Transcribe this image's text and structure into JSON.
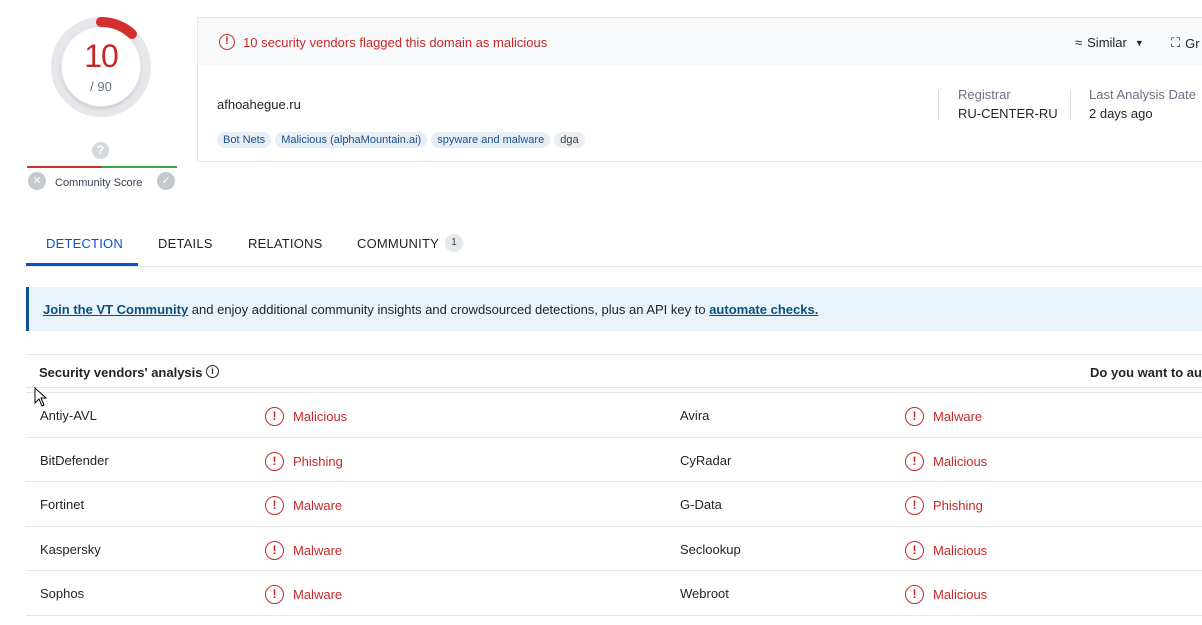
{
  "score": {
    "detections": "10",
    "total": "/ 90",
    "community_label": "Community Score"
  },
  "alert": {
    "text": "10 security vendors flagged this domain as malicious"
  },
  "toolbar": {
    "similar_label": "Similar",
    "graph_label": "Gr"
  },
  "domain": "afhoahegue.ru",
  "tags": [
    "Bot Nets",
    "Malicious (alphaMountain.ai)",
    "spyware and malware",
    "dga"
  ],
  "meta": {
    "registrar_label": "Registrar",
    "registrar_value": "RU-CENTER-RU",
    "last_analysis_label": "Last Analysis Date",
    "last_analysis_value": "2 days ago"
  },
  "tabs": [
    {
      "label": "DETECTION"
    },
    {
      "label": "DETAILS"
    },
    {
      "label": "RELATIONS"
    },
    {
      "label": "COMMUNITY",
      "badge": "1"
    }
  ],
  "banner": {
    "link1": "Join the VT Community",
    "middle": " and enjoy additional community insights and crowdsourced detections, plus an API key to ",
    "link2": "automate checks."
  },
  "vendors": {
    "title": "Security vendors' analysis",
    "right_text": "Do you want to aut",
    "rows": [
      {
        "left": {
          "name": "Antiy-AVL",
          "result": "Malicious"
        },
        "right": {
          "name": "Avira",
          "result": "Malware"
        }
      },
      {
        "left": {
          "name": "BitDefender",
          "result": "Phishing"
        },
        "right": {
          "name": "CyRadar",
          "result": "Malicious"
        }
      },
      {
        "left": {
          "name": "Fortinet",
          "result": "Malware"
        },
        "right": {
          "name": "G-Data",
          "result": "Phishing"
        }
      },
      {
        "left": {
          "name": "Kaspersky",
          "result": "Malware"
        },
        "right": {
          "name": "Seclookup",
          "result": "Malicious"
        }
      },
      {
        "left": {
          "name": "Sophos",
          "result": "Malware"
        },
        "right": {
          "name": "Webroot",
          "result": "Malicious"
        }
      }
    ]
  },
  "colors": {
    "malicious": "#c62828",
    "accent": "#0b4fd1",
    "banner_bg": "#e8f3fc"
  }
}
